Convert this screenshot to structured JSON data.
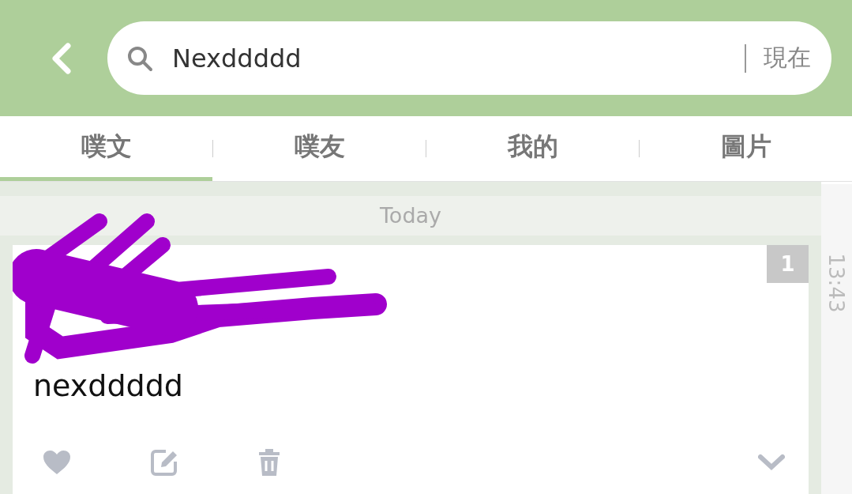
{
  "search": {
    "value": "Nexddddd",
    "scope": "現在"
  },
  "tabs": [
    {
      "label": "噗文",
      "selected": true
    },
    {
      "label": "噗友",
      "selected": false
    },
    {
      "label": "我的",
      "selected": false
    },
    {
      "label": "圖片",
      "selected": false
    }
  ],
  "date_header": "Today",
  "post": {
    "count": "1",
    "content": "nexddddd",
    "time": "13:43"
  }
}
